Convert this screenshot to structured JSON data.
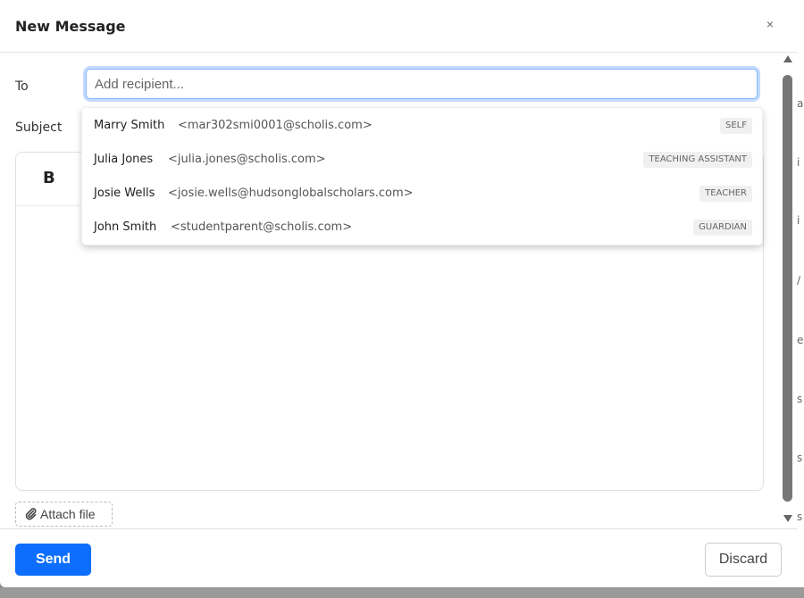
{
  "modal": {
    "title": "New Message",
    "close_glyph": "×"
  },
  "compose": {
    "to_label": "To",
    "subject_label": "Subject",
    "recipient_placeholder": "Add recipient...",
    "recipient_value": ""
  },
  "toolbar": {
    "bold_label": "B"
  },
  "suggestions": [
    {
      "name": "Marry Smith",
      "email": "<mar302smi0001@scholis.com>",
      "role": "SELF"
    },
    {
      "name": "Julia Jones",
      "email": "<julia.jones@scholis.com>",
      "role": "TEACHING ASSISTANT"
    },
    {
      "name": "Josie Wells",
      "email": "<josie.wells@hudsonglobalscholars.com>",
      "role": "TEACHER"
    },
    {
      "name": "John Smith",
      "email": "<studentparent@scholis.com>",
      "role": "GUARDIAN"
    }
  ],
  "attach": {
    "label": "Attach file",
    "icon": "paperclip-icon"
  },
  "footer": {
    "send_label": "Send",
    "discard_label": "Discard"
  },
  "background_fragments": [
    "a",
    "i",
    "i",
    "/",
    "e",
    "s",
    "s",
    "s"
  ],
  "colors": {
    "primary": "#0d6efd",
    "focus_border": "#86b7fe",
    "backdrop": "#888888"
  }
}
